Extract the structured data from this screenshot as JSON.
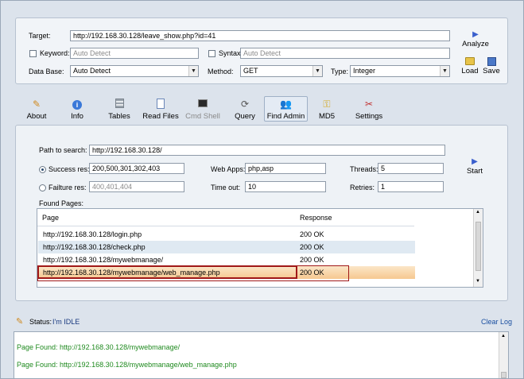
{
  "target": {
    "label": "Target:",
    "value": "http://192.168.30.128/leave_show.php?id=41"
  },
  "keyword": {
    "label": "Keyword:",
    "placeholder": "Auto Detect"
  },
  "syntax": {
    "label": "Syntax:",
    "placeholder": "Auto Detect"
  },
  "database": {
    "label": "Data Base:",
    "value": "Auto Detect"
  },
  "method": {
    "label": "Method:",
    "value": "GET"
  },
  "type": {
    "label": "Type:",
    "value": "Integer"
  },
  "actions": {
    "analyze": "Analyze",
    "load": "Load",
    "save": "Save"
  },
  "toolbar": [
    {
      "label": "About",
      "icon": "pencil-icon"
    },
    {
      "label": "Info",
      "icon": "info-icon"
    },
    {
      "label": "Tables",
      "icon": "tables-icon"
    },
    {
      "label": "Read Files",
      "icon": "document-icon"
    },
    {
      "label": "Cmd Shell",
      "icon": "terminal-icon"
    },
    {
      "label": "Query",
      "icon": "query-icon"
    },
    {
      "label": "Find Admin",
      "icon": "users-icon"
    },
    {
      "label": "MD5",
      "icon": "key-icon"
    },
    {
      "label": "Settings",
      "icon": "tools-icon"
    }
  ],
  "find_admin": {
    "path_label": "Path to search:",
    "path_value": "http://192.168.30.128/",
    "success_label": "Success res:",
    "success_value": "200,500,301,302,403",
    "failure_label": "Failture res:",
    "failure_placeholder": "400,401,404",
    "webapps_label": "Web Apps:",
    "webapps_value": "php,asp",
    "timeout_label": "Time out:",
    "timeout_value": "10",
    "threads_label": "Threads:",
    "threads_value": "5",
    "retries_label": "Retries:",
    "retries_value": "1",
    "start": "Start",
    "found_label": "Found Pages:",
    "columns": {
      "page": "Page",
      "response": "Response"
    },
    "rows": [
      {
        "page": "http://192.168.30.128/login.php",
        "response": "200 OK"
      },
      {
        "page": "http://192.168.30.128/check.php",
        "response": "200 OK"
      },
      {
        "page": "http://192.168.30.128/mywebmanage/",
        "response": "200 OK"
      },
      {
        "page": "http://192.168.30.128/mywebmanage/web_manage.php",
        "response": "200 OK"
      }
    ]
  },
  "status": {
    "label": "Status:",
    "value": "I'm IDLE",
    "clear": "Clear Log"
  },
  "log": [
    "Page Found: http://192.168.30.128/mywebmanage/",
    "Page Found: http://192.168.30.128/mywebmanage/web_manage.php"
  ],
  "colors": {
    "accent": "#1a4fa0",
    "highlight": "#f9d9a8",
    "log_text": "#1f8a1f",
    "selection_border": "#a01818"
  }
}
